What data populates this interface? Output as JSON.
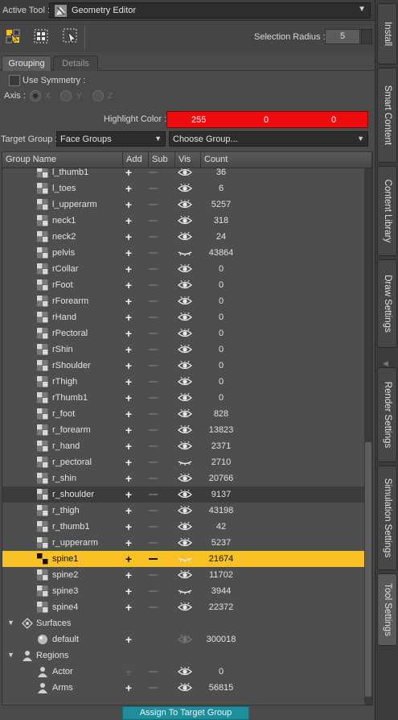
{
  "header": {
    "active_tool_label": "Active Tool :",
    "active_tool_value": "Geometry Editor"
  },
  "toolbar": {
    "selection_radius_label": "Selection Radius :",
    "selection_radius_value": "5"
  },
  "tabs": [
    {
      "label": "Grouping",
      "active": true
    },
    {
      "label": "Details",
      "active": false
    }
  ],
  "symmetry": {
    "use_symmetry_label": "Use Symmetry :",
    "checked": false,
    "axis_label": "Axis :",
    "axes": [
      "X",
      "Y",
      "Z"
    ],
    "selected_axis": "X"
  },
  "highlight": {
    "label": "Highlight Color :",
    "r": "255",
    "g": "0",
    "b": "0",
    "color": "#ee0c0c"
  },
  "target_group": {
    "label": "Target Group :",
    "value": "Face Groups",
    "choose_placeholder": "Choose Group..."
  },
  "grid": {
    "columns": [
      "Group Name",
      "Add",
      "Sub",
      "Vis",
      "Count"
    ],
    "rows": [
      {
        "name": "l_thumb1",
        "count": "36",
        "vis": "open"
      },
      {
        "name": "l_toes",
        "count": "6",
        "vis": "open"
      },
      {
        "name": "l_upperarm",
        "count": "5257",
        "vis": "open"
      },
      {
        "name": "neck1",
        "count": "318",
        "vis": "open"
      },
      {
        "name": "neck2",
        "count": "24",
        "vis": "open"
      },
      {
        "name": "pelvis",
        "count": "43864",
        "vis": "closed"
      },
      {
        "name": "rCollar",
        "count": "0",
        "vis": "open"
      },
      {
        "name": "rFoot",
        "count": "0",
        "vis": "open"
      },
      {
        "name": "rForearm",
        "count": "0",
        "vis": "open"
      },
      {
        "name": "rHand",
        "count": "0",
        "vis": "open"
      },
      {
        "name": "rPectoral",
        "count": "0",
        "vis": "open"
      },
      {
        "name": "rShin",
        "count": "0",
        "vis": "open"
      },
      {
        "name": "rShoulder",
        "count": "0",
        "vis": "open"
      },
      {
        "name": "rThigh",
        "count": "0",
        "vis": "open"
      },
      {
        "name": "rThumb1",
        "count": "0",
        "vis": "open"
      },
      {
        "name": "r_foot",
        "count": "828",
        "vis": "open"
      },
      {
        "name": "r_forearm",
        "count": "13823",
        "vis": "open"
      },
      {
        "name": "r_hand",
        "count": "2371",
        "vis": "open"
      },
      {
        "name": "r_pectoral",
        "count": "2710",
        "vis": "closed"
      },
      {
        "name": "r_shin",
        "count": "20766",
        "vis": "open"
      },
      {
        "name": "r_shoulder",
        "count": "9137",
        "vis": "open",
        "hover": true
      },
      {
        "name": "r_thigh",
        "count": "43198",
        "vis": "open"
      },
      {
        "name": "r_thumb1",
        "count": "42",
        "vis": "open"
      },
      {
        "name": "r_upperarm",
        "count": "5237",
        "vis": "open"
      },
      {
        "name": "spine1",
        "count": "21674",
        "vis": "closed",
        "selected": true
      },
      {
        "name": "spine2",
        "count": "11702",
        "vis": "open"
      },
      {
        "name": "spine3",
        "count": "3944",
        "vis": "closed"
      },
      {
        "name": "spine4",
        "count": "22372",
        "vis": "open"
      }
    ],
    "sections": {
      "surfaces": {
        "label": "Surfaces",
        "items": [
          {
            "name": "default",
            "count": "300018"
          }
        ]
      },
      "regions": {
        "label": "Regions",
        "items": [
          {
            "name": "Actor",
            "count": "0"
          },
          {
            "name": "Arms",
            "count": "56815"
          }
        ]
      }
    }
  },
  "footer": {
    "assign_button": "Assign To Target Group"
  },
  "sidebar_tabs": [
    "Install",
    "Smart Content",
    "Content Library",
    "Draw Settings",
    "Render Settings",
    "Simulation Settings",
    "Tool Settings"
  ],
  "colors": {
    "selection": "#f7c126",
    "assign_button": "#1e8e9b"
  }
}
